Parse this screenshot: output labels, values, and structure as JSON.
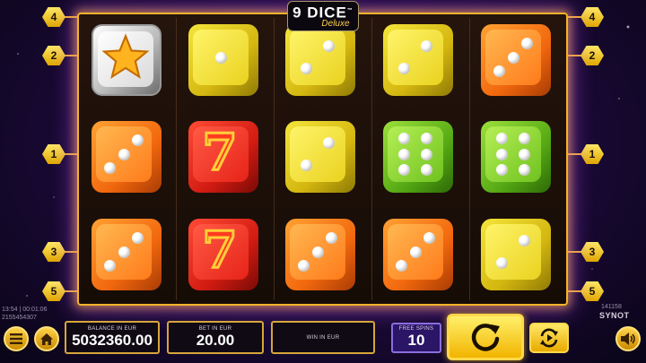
{
  "game": {
    "logo_main": "9 DICE",
    "logo_tm": "™",
    "logo_sub": "Deluxe",
    "brand": "SYNOT"
  },
  "info": {
    "left_line1": "13:54 | 00:01:06",
    "left_line2": "2155454307",
    "right_line1": "141158"
  },
  "paylines": {
    "left": [
      "4",
      "2",
      "1",
      "3",
      "5"
    ],
    "right": [
      "4",
      "2",
      "1",
      "3",
      "5"
    ]
  },
  "grid": [
    [
      "silver-star",
      "yellow-1",
      "yellow-2",
      "yellow-2",
      "orange-3"
    ],
    [
      "orange-3",
      "red-seven",
      "yellow-2",
      "green-6",
      "green-6"
    ],
    [
      "orange-3",
      "red-seven",
      "orange-3",
      "orange-3",
      "yellow-2"
    ]
  ],
  "bottom_bar": {
    "balance_label": "BALANCE IN EUR",
    "balance_value": "5032360.00",
    "bet_label": "BET IN EUR",
    "bet_value": "20.00",
    "win_label": "WIN IN EUR",
    "win_value": "",
    "free_spins_label": "FREE SPINS",
    "free_spins_value": "10"
  },
  "icons": {
    "menu": "menu-icon",
    "home": "home-icon",
    "spin": "spin-icon",
    "autoplay": "autoplay-icon",
    "sound": "sound-icon"
  },
  "colors": {
    "frame": "#f5b32b",
    "background": "#1c0a3a",
    "accent": "#ffd34d"
  }
}
